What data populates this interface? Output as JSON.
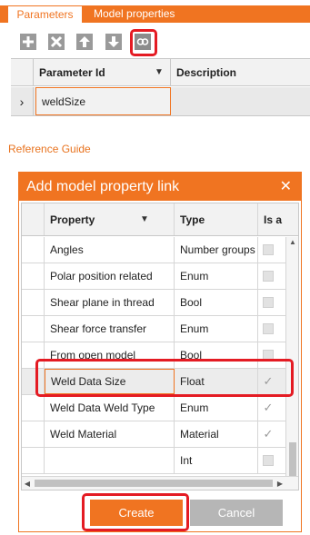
{
  "tabs": [
    {
      "label": "Parameters",
      "active": true
    },
    {
      "label": "Model properties",
      "active": false
    }
  ],
  "toolbar": {
    "icons": [
      "add-icon",
      "delete-icon",
      "move-up-icon",
      "move-down-icon",
      "link-icon"
    ]
  },
  "parameters_grid": {
    "columns": [
      "Parameter Id",
      "Description"
    ],
    "rows": [
      {
        "expander": "›",
        "parameter_id": "weldSize",
        "description": ""
      }
    ]
  },
  "reference_guide": "Reference Guide",
  "dialog": {
    "title": "Add model property link",
    "close_glyph": "✕",
    "columns": [
      "Property",
      "Type",
      "Is a"
    ],
    "rows": [
      {
        "property": "Angles",
        "type": "Number groups",
        "checked": false
      },
      {
        "property": "Polar position related",
        "type": "Enum",
        "checked": false
      },
      {
        "property": "Shear plane in thread",
        "type": "Bool",
        "checked": false
      },
      {
        "property": "Shear force transfer",
        "type": "Enum",
        "checked": false
      },
      {
        "property": "From open model",
        "type": "Bool",
        "checked": false
      },
      {
        "property": "Weld Data Size",
        "type": "Float",
        "checked": true,
        "selected": true
      },
      {
        "property": "Weld Data Weld Type",
        "type": "Enum",
        "checked": true
      },
      {
        "property": "Weld Material",
        "type": "Material",
        "checked": true
      },
      {
        "property": "",
        "type": "Int",
        "checked": false
      }
    ],
    "create_label": "Create",
    "cancel_label": "Cancel"
  },
  "colors": {
    "accent": "#f07421",
    "highlight": "#e41b23",
    "button_gray": "#b6b6b6"
  }
}
